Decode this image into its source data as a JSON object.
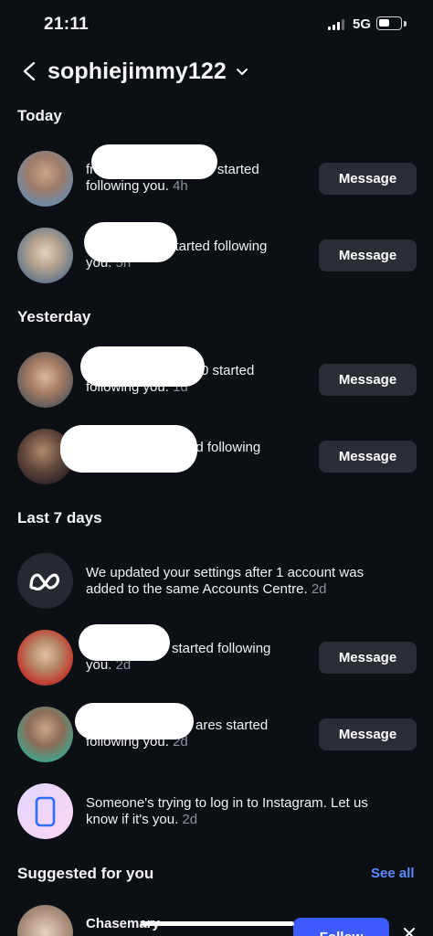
{
  "status_bar": {
    "time": "21:11",
    "network": "5G"
  },
  "header": {
    "title": "sophiejimmy122"
  },
  "sections": {
    "today": "Today",
    "yesterday": "Yesterday",
    "last7": "Last 7 days",
    "suggested": "Suggested for you"
  },
  "notifications": [
    {
      "prefix": "franc",
      "mid": "2 started",
      "line2": "following you.",
      "time": "4h",
      "button": "Message"
    },
    {
      "prefix": "",
      "mid": "started following",
      "line2": "you.",
      "time": "5h",
      "button": "Message"
    },
    {
      "prefix": "",
      "mid": "0 started",
      "line2": "following you.",
      "time": "1d",
      "button": "Message"
    },
    {
      "prefix": "",
      "mid": "ed following",
      "line2": "",
      "time": "1d",
      "button": "Message"
    },
    {
      "text": "We updated your settings after 1 account was added to the same Accounts Centre.",
      "time": "2d"
    },
    {
      "prefix": "",
      "mid": "started following",
      "line2": "you.",
      "time": "2d",
      "button": "Message"
    },
    {
      "prefix": "",
      "mid": "ares started",
      "line2": "following you.",
      "time": "2d",
      "button": "Message"
    },
    {
      "text": "Someone's trying to log in to Instagram. Let us know if it's you.",
      "time": "2d"
    }
  ],
  "suggested": {
    "see_all": "See all",
    "name": "Chasemary",
    "follow": "Follow"
  },
  "colors": {
    "background": "#0c0f14",
    "button": "#2a2d33",
    "link": "#5c8aff",
    "follow": "#3d5afe"
  },
  "icons": [
    "back-icon",
    "chevron-down-icon",
    "meta-logo-icon",
    "phone-icon",
    "close-icon"
  ]
}
